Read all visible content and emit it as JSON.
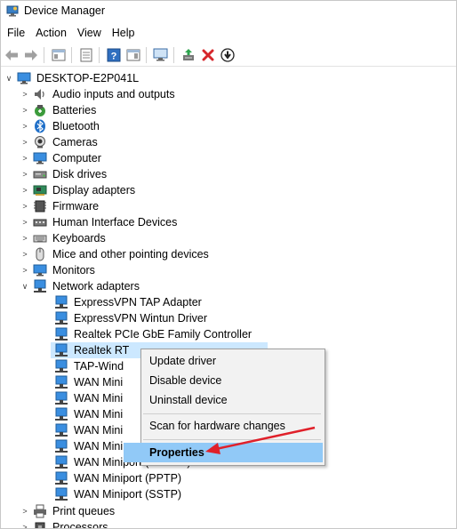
{
  "window": {
    "title": "Device Manager"
  },
  "menu": [
    "File",
    "Action",
    "View",
    "Help"
  ],
  "toolbar_icons": [
    "back-arrow-icon",
    "forward-arrow-icon",
    "show-hide-console-tree-icon",
    "properties-sheet-icon",
    "help-icon",
    "action-pane-icon",
    "monitor-scan-icon",
    "update-driver-icon",
    "uninstall-device-icon",
    "disable-device-icon"
  ],
  "tree": {
    "root": "DESKTOP-E2P041L",
    "categories": [
      {
        "label": "Audio inputs and outputs",
        "icon": "speaker-icon"
      },
      {
        "label": "Batteries",
        "icon": "battery-icon"
      },
      {
        "label": "Bluetooth",
        "icon": "bluetooth-icon"
      },
      {
        "label": "Cameras",
        "icon": "camera-icon"
      },
      {
        "label": "Computer",
        "icon": "computer-icon"
      },
      {
        "label": "Disk drives",
        "icon": "disk-drive-icon"
      },
      {
        "label": "Display adapters",
        "icon": "display-adapter-icon"
      },
      {
        "label": "Firmware",
        "icon": "firmware-icon"
      },
      {
        "label": "Human Interface Devices",
        "icon": "hid-icon"
      },
      {
        "label": "Keyboards",
        "icon": "keyboard-icon"
      },
      {
        "label": "Mice and other pointing devices",
        "icon": "mouse-icon"
      },
      {
        "label": "Monitors",
        "icon": "monitor-icon"
      },
      {
        "label": "Network adapters",
        "icon": "network-adapter-icon",
        "expanded": true
      }
    ],
    "network_adapters": [
      "ExpressVPN TAP Adapter",
      "ExpressVPN Wintun Driver",
      "Realtek PCIe GbE Family Controller",
      "Realtek RT",
      "TAP-Wind",
      "WAN Mini",
      "WAN Mini",
      "WAN Mini",
      "WAN Mini",
      "WAN Mini",
      "WAN Miniport (PPPOE)",
      "WAN Miniport (PPTP)",
      "WAN Miniport (SSTP)"
    ],
    "after": [
      {
        "label": "Print queues",
        "icon": "printer-icon"
      },
      {
        "label": "Processors",
        "icon": "processor-icon"
      }
    ]
  },
  "context_menu": {
    "items": [
      "Update driver",
      "Disable device",
      "Uninstall device",
      "Scan for hardware changes",
      "Properties"
    ],
    "highlighted": "Properties"
  },
  "colors": {
    "selection": "#cce8ff",
    "menu_highlight": "#91c9f7",
    "annotation_arrow": "#e0202a"
  }
}
